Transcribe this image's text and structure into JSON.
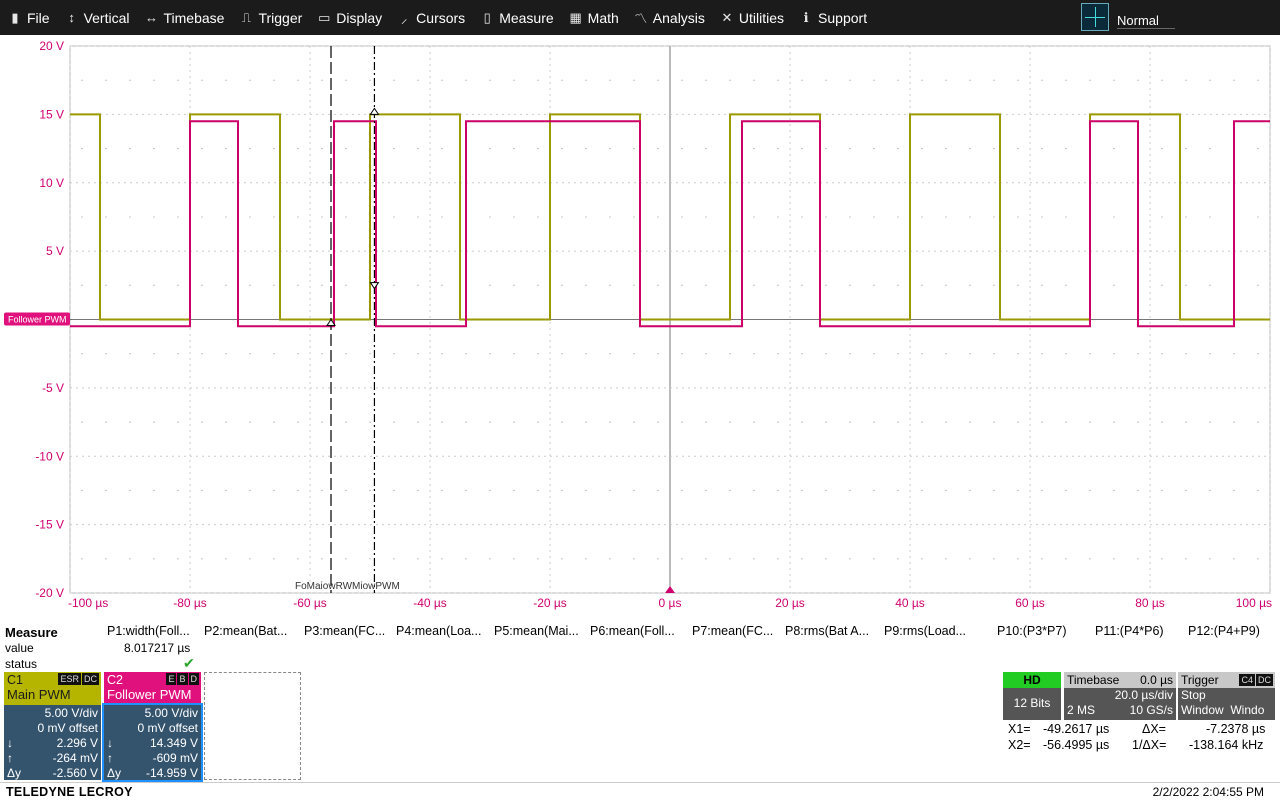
{
  "menu": {
    "items": [
      {
        "label": "File",
        "icon": "file-icon",
        "glyph": "▮"
      },
      {
        "label": "Vertical",
        "icon": "vertical-icon",
        "glyph": "↕"
      },
      {
        "label": "Timebase",
        "icon": "timebase-icon",
        "glyph": "↔"
      },
      {
        "label": "Trigger",
        "icon": "trigger-icon",
        "glyph": "⎍"
      },
      {
        "label": "Display",
        "icon": "display-icon",
        "glyph": "▭"
      },
      {
        "label": "Cursors",
        "icon": "cursors-icon",
        "glyph": "⸝"
      },
      {
        "label": "Measure",
        "icon": "measure-icon",
        "glyph": "▯"
      },
      {
        "label": "Math",
        "icon": "math-icon",
        "glyph": "▦"
      },
      {
        "label": "Analysis",
        "icon": "analysis-icon",
        "glyph": "〽"
      },
      {
        "label": "Utilities",
        "icon": "utilities-icon",
        "glyph": "✕"
      },
      {
        "label": "Support",
        "icon": "support-icon",
        "glyph": "ℹ"
      }
    ],
    "mode": "Normal"
  },
  "grid": {
    "y_labels": [
      "20 V",
      "15 V",
      "10 V",
      "5 V",
      "0 V",
      "-5 V",
      "-10 V",
      "-15 V",
      "-20 V"
    ],
    "x_labels": [
      "-100 µs",
      "-80 µs",
      "-60 µs",
      "-40 µs",
      "-20 µs",
      "0 µs",
      "20 µs",
      "40 µs",
      "60 µs",
      "80 µs",
      "100 µs"
    ],
    "follower_marker": "Follower PWM",
    "cursor_label_text": "FoMaiowRWMiowPWM"
  },
  "chart_data": {
    "type": "line",
    "title": "",
    "xlabel": "",
    "ylabel": "",
    "x_unit": "µs",
    "y_unit": "V",
    "xlim": [
      -100,
      100
    ],
    "ylim": [
      -20,
      20
    ],
    "grid": true,
    "series": [
      {
        "name": "Main PWM",
        "color": "#9a9a00",
        "x": [
          -100,
          -95,
          -95,
          -80,
          -80,
          -65,
          -65,
          -50,
          -50,
          -35,
          -35,
          -20,
          -20,
          -5,
          -5,
          10,
          10,
          25,
          25,
          40,
          40,
          55,
          55,
          70,
          70,
          85,
          85,
          100
        ],
        "y": [
          15,
          15,
          0,
          0,
          15,
          15,
          0,
          0,
          15,
          15,
          0,
          0,
          15,
          15,
          0,
          0,
          15,
          15,
          0,
          0,
          15,
          15,
          0,
          0,
          15,
          15,
          0,
          0
        ]
      },
      {
        "name": "Follower PWM",
        "color": "#cc0066",
        "x": [
          -100,
          -80,
          -80,
          -72,
          -72,
          -56,
          -56,
          -49,
          -49,
          -34,
          -34,
          -5,
          -5,
          12,
          12,
          25,
          25,
          70,
          70,
          78,
          78,
          94,
          94,
          100
        ],
        "y": [
          -0.5,
          -0.5,
          14.5,
          14.5,
          -0.5,
          -0.5,
          14.5,
          14.5,
          -0.5,
          -0.5,
          14.5,
          14.5,
          -0.5,
          -0.5,
          14.5,
          14.5,
          -0.5,
          -0.5,
          14.5,
          14.5,
          -0.5,
          -0.5,
          14.5,
          14.5
        ]
      }
    ],
    "cursors": {
      "x1": -49.2617,
      "x2": -56.4995
    }
  },
  "measure": {
    "title": "Measure",
    "params": [
      "P1:width(Foll...",
      "P2:mean(Bat...",
      "P3:mean(FC...",
      "P4:mean(Loa...",
      "P5:mean(Mai...",
      "P6:mean(Foll...",
      "P7:mean(FC...",
      "P8:rms(Bat A...",
      "P9:rms(Load...",
      "P10:(P3*P7)",
      "P11:(P4*P6)",
      "P12:(P4+P9)"
    ],
    "value_label": "value",
    "value": "8.017217 µs",
    "status_label": "status",
    "status_check": "✔"
  },
  "channels": {
    "c1": {
      "name": "C1",
      "desc": "Main PWM",
      "tags": [
        "ESR",
        "DC"
      ],
      "vdiv": "5.00 V/div",
      "offset": "0 mV offset",
      "down_sym": "↓",
      "down": "2.296 V",
      "up_sym": "↑",
      "up": "-264 mV",
      "dy_sym": "Δy",
      "dy": "-2.560 V"
    },
    "c2": {
      "name": "C2",
      "desc": "Follower PWM",
      "tags": [
        "E",
        "B",
        "D"
      ],
      "vdiv": "5.00 V/div",
      "offset": "0 mV offset",
      "down_sym": "↓",
      "down": "14.349 V",
      "up_sym": "↑",
      "up": "-609 mV",
      "dy_sym": "Δy",
      "dy": "-14.959 V"
    }
  },
  "acq": {
    "hd": "HD",
    "bits": "12 Bits",
    "timebase_label": "Timebase",
    "timebase_delay": "0.0 µs",
    "tdiv": "20.0 µs/div",
    "samples": "2 MS",
    "rate": "10 GS/s",
    "trigger_label": "Trigger",
    "trigger_tags": [
      "C4",
      "DC"
    ],
    "trigger_mode": "Stop",
    "trigger_type": "Window",
    "trigger_type2": "Windo"
  },
  "cursors_readout": {
    "x1_label": "X1=",
    "x1": "-49.2617 µs",
    "dx_label": "ΔX=",
    "dx": "-7.2378 µs",
    "x2_label": "X2=",
    "x2": "-56.4995 µs",
    "inv_label": "1/ΔX=",
    "inv": "-138.164 kHz"
  },
  "footer": {
    "brand": "TELEDYNE LECROY",
    "datetime": "2/2/2022 2:04:55 PM"
  }
}
